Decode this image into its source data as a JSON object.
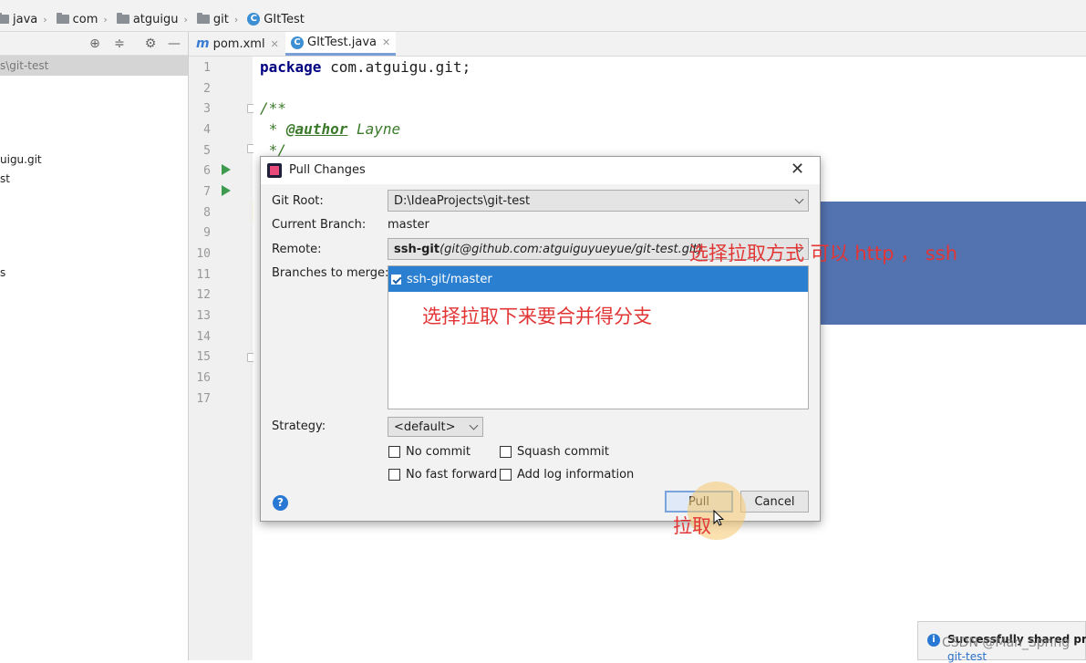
{
  "breadcrumb": {
    "items": [
      {
        "label": "java",
        "icon": "folder-icon"
      },
      {
        "label": "com",
        "icon": "folder-icon"
      },
      {
        "label": "atguigu",
        "icon": "folder-icon"
      },
      {
        "label": "git",
        "icon": "folder-icon"
      },
      {
        "label": "GItTest",
        "icon": "class-icon"
      }
    ]
  },
  "project": {
    "selected_path": "s\\git-test",
    "items": [
      "uigu.git",
      "st",
      "s"
    ]
  },
  "tabs": [
    {
      "label": "pom.xml",
      "icon": "maven-icon"
    },
    {
      "label": "GItTest.java",
      "icon": "class-icon",
      "active": true
    }
  ],
  "code": {
    "line_numbers": [
      "1",
      "2",
      "3",
      "4",
      "5",
      "6",
      "7",
      "8",
      "9",
      "10",
      "11",
      "12",
      "13",
      "14",
      "15",
      "16",
      "17"
    ],
    "line1_keyword": "package",
    "line1_rest": " com.atguigu.git;",
    "line3": "/**",
    "line4_prefix": " * ",
    "line4_tag": "@author",
    "line4_rest": " Layne",
    "line5": " */"
  },
  "dialog": {
    "title": "Pull Changes",
    "git_root_label": "Git Root:",
    "git_root_value": "D:\\IdeaProjects\\git-test",
    "current_branch_label": "Current Branch:",
    "current_branch_value": "master",
    "remote_label": "Remote:",
    "remote_name": "ssh-git",
    "remote_url": "(git@github.com:atguiguyueyue/git-test.git)",
    "branches_label": "Branches to merge:",
    "branches": [
      {
        "name": "ssh-git/master",
        "checked": true
      }
    ],
    "strategy_label": "Strategy:",
    "strategy_value": "<default>",
    "options": {
      "no_commit": "No commit",
      "squash_commit": "Squash commit",
      "no_fast_forward": "No fast forward",
      "add_log": "Add log information"
    },
    "help": "?",
    "pull_button": "Pull",
    "cancel_button": "Cancel"
  },
  "annotations": {
    "remote_note": "选择拉取方式 可以 http ， ssh",
    "branch_note": "选择拉取下来要合并得分支",
    "pull_note": "拉取"
  },
  "notification": {
    "text": "Successfully shared proje",
    "link": "git-test"
  },
  "watermark": "CSDN @Man_Spring",
  "colors": {
    "selection_blue": "#2a7fd0",
    "annotation_red": "#e23535",
    "editor_selection": "#5373b0"
  }
}
